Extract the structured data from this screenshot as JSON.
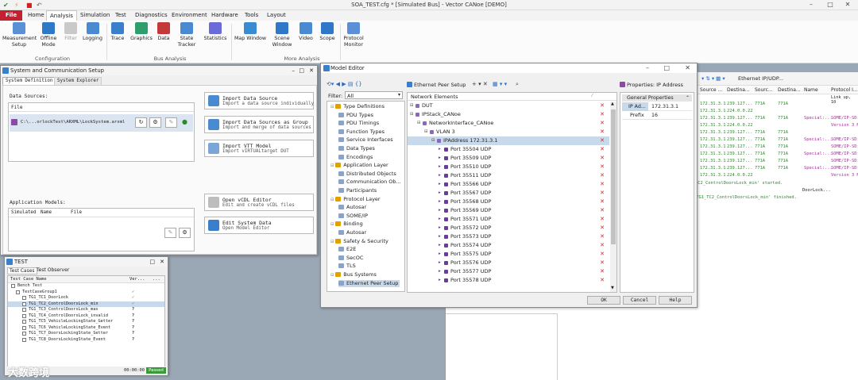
{
  "app": {
    "title": "SOA_TEST.cfg * [Simulated Bus] - Vector CANoe [DEMO]"
  },
  "menu": {
    "items": [
      "File",
      "Home",
      "Analysis",
      "Simulation",
      "Test",
      "Diagnostics",
      "Environment",
      "Hardware",
      "Tools",
      "Layout"
    ],
    "active": "Analysis"
  },
  "ribbon": {
    "buttons": [
      {
        "label": "Measurement\nSetup",
        "icon": "measurement-setup-icon"
      },
      {
        "label": "Offline\nMode",
        "icon": "offline-mode-icon"
      },
      {
        "label": "Filter",
        "icon": "filter-icon"
      },
      {
        "label": "Logging",
        "icon": "logging-icon"
      },
      {
        "label": "Trace",
        "icon": "trace-icon"
      },
      {
        "label": "Graphics",
        "icon": "graphics-icon"
      },
      {
        "label": "Data",
        "icon": "data-icon"
      },
      {
        "label": "State\nTracker",
        "icon": "state-tracker-icon"
      },
      {
        "label": "Statistics",
        "icon": "statistics-icon"
      },
      {
        "label": "Map Window",
        "icon": "map-window-icon"
      },
      {
        "label": "Scene\nWindow",
        "icon": "scene-window-icon"
      },
      {
        "label": "Video",
        "icon": "video-icon"
      },
      {
        "label": "Scope",
        "icon": "scope-icon"
      },
      {
        "label": "Protocol\nMonitor",
        "icon": "protocol-monitor-icon"
      }
    ],
    "groups": [
      "Configuration",
      "Bus Analysis",
      "More Analysis"
    ]
  },
  "setup": {
    "title": "System and Communication Setup",
    "tabs": [
      "System Definition",
      "System Explorer"
    ],
    "data_sources_label": "Data Sources:",
    "file_col": "File",
    "file_value": "C:\\...orlockTest\\ARXML\\LockSystem.arxml",
    "app_models_label": "Application Models:",
    "app_cols": [
      "Simulated",
      "Name",
      "File"
    ],
    "actions": [
      {
        "title": "Import Data Source",
        "sub": "Import a data source individually"
      },
      {
        "title": "Import Data Sources as Group",
        "sub": "Import and merge of data sources"
      },
      {
        "title": "Import VTT Model",
        "sub": "Import vIRTUALtarget DUT"
      },
      {
        "title": "Open vCDL Editor",
        "sub": "Edit and create vCDL files"
      },
      {
        "title": "Edit System Data",
        "sub": "Open Model Editor"
      }
    ]
  },
  "test": {
    "title": "TEST",
    "tabs": [
      "Test Cases",
      "Test Observer"
    ],
    "cols": [
      "Test Case Name",
      "Ver...",
      "..."
    ],
    "items": [
      {
        "name": "Bench Test",
        "verdict": ""
      },
      {
        "name": "TestCaseGroup1",
        "verdict": "✓"
      },
      {
        "name": "TG1_TC1_DoorLock",
        "verdict": "✓"
      },
      {
        "name": "TG1_TC2_ControlDoorsLock_min",
        "verdict": "✓"
      },
      {
        "name": "TG1_TC3_ControlDoorsLock_max",
        "verdict": "?"
      },
      {
        "name": "TG1_TC4_ControlDoorsLock_invalid",
        "verdict": "?"
      },
      {
        "name": "TG1_TC5_VehicleLockingState_Getter",
        "verdict": "?"
      },
      {
        "name": "TG1_TC6_VehicleLockingState_Event",
        "verdict": "?"
      },
      {
        "name": "TG1_TC7_DoorsLockingState_Setter",
        "verdict": "?"
      },
      {
        "name": "TG1_TC8_DoorsLockingState_Event",
        "verdict": "?"
      }
    ],
    "time": "00:00:00",
    "status": "Passed",
    "watermark": "大数跨境"
  },
  "model_editor": {
    "title": "Model Editor",
    "filter_label": "Filter:",
    "filter_value": "All",
    "tree": [
      {
        "label": "Type Definitions",
        "level": 1
      },
      {
        "label": "PDU Types",
        "level": 2
      },
      {
        "label": "PDU Timings",
        "level": 2
      },
      {
        "label": "Function Types",
        "level": 2
      },
      {
        "label": "Service Interfaces",
        "level": 2
      },
      {
        "label": "Data Types",
        "level": 2
      },
      {
        "label": "Encodings",
        "level": 2
      },
      {
        "label": "Application Layer",
        "level": 1
      },
      {
        "label": "Distributed Objects",
        "level": 2
      },
      {
        "label": "Communication Ob...",
        "level": 2
      },
      {
        "label": "Participants",
        "level": 2
      },
      {
        "label": "Protocol Layer",
        "level": 1
      },
      {
        "label": "Autosar",
        "level": 2
      },
      {
        "label": "SOME/IP",
        "level": 2
      },
      {
        "label": "Binding",
        "level": 1
      },
      {
        "label": "Autosar",
        "level": 2
      },
      {
        "label": "Safety & Security",
        "level": 1
      },
      {
        "label": "E2E",
        "level": 2
      },
      {
        "label": "SecOC",
        "level": 2
      },
      {
        "label": "TLS",
        "level": 2
      },
      {
        "label": "Bus Systems",
        "level": 1
      },
      {
        "label": "Ethernet Peer Setup",
        "level": 2
      }
    ],
    "peer_setup_title": "Ethernet Peer Setup",
    "network_header": "Network Elements",
    "network_rows": [
      {
        "label": "DUT",
        "level": 0
      },
      {
        "label": "IPStack_CANoe",
        "level": 0
      },
      {
        "label": "NetworkInterface_CANoe",
        "level": 1
      },
      {
        "label": "VLAN 3",
        "level": 2
      },
      {
        "label": "IPAddress 172.31.3.1",
        "level": 3
      },
      {
        "label": "Port 35504 UDP",
        "level": 4
      },
      {
        "label": "Port 35509 UDP",
        "level": 4
      },
      {
        "label": "Port 35510 UDP",
        "level": 4
      },
      {
        "label": "Port 35511 UDP",
        "level": 4
      },
      {
        "label": "Port 35566 UDP",
        "level": 4
      },
      {
        "label": "Port 35567 UDP",
        "level": 4
      },
      {
        "label": "Port 35568 UDP",
        "level": 4
      },
      {
        "label": "Port 35569 UDP",
        "level": 4
      },
      {
        "label": "Port 35571 UDP",
        "level": 4
      },
      {
        "label": "Port 35572 UDP",
        "level": 4
      },
      {
        "label": "Port 35573 UDP",
        "level": 4
      },
      {
        "label": "Port 35574 UDP",
        "level": 4
      },
      {
        "label": "Port 35575 UDP",
        "level": 4
      },
      {
        "label": "Port 35576 UDP",
        "level": 4
      },
      {
        "label": "Port 35577 UDP",
        "level": 4
      },
      {
        "label": "Port 35578 UDP",
        "level": 4
      }
    ],
    "props_title": "Properties: IP Address",
    "props_header": "General Properties",
    "props": [
      {
        "key": "IP Ad...",
        "value": "172.31.3.1"
      },
      {
        "key": "Prefix",
        "value": "16"
      }
    ],
    "buttons": {
      "ok": "OK",
      "cancel": "Cancel",
      "help": "Help"
    }
  },
  "trace": {
    "toolbar_label": "Ethernet IP/UDP...",
    "cols": [
      "Source ...",
      "Destina...",
      "Sourc...",
      "Destina...",
      "Name",
      "Protocol I..."
    ],
    "link_up": "Link up, 10",
    "rows": [
      {
        "src": "172.31.3.1",
        "dst": "239.127...",
        "sp": "771A",
        "dp": "771A",
        "name": "",
        "proto": ""
      },
      {
        "src": "172.31.3.1",
        "dst": "224.0.0.22",
        "sp": "",
        "dp": "",
        "name": "",
        "proto": ""
      },
      {
        "src": "172.31.3.1",
        "dst": "239.127...",
        "sp": "771A",
        "dp": "771A",
        "name": "Special:...",
        "proto": "SOME/IP-SD:"
      },
      {
        "src": "172.31.3.1",
        "dst": "224.0.0.22",
        "sp": "",
        "dp": "",
        "name": "",
        "proto": "Version 3 M"
      },
      {
        "src": "172.31.3.1",
        "dst": "239.127...",
        "sp": "771A",
        "dp": "771A",
        "name": "",
        "proto": ""
      },
      {
        "src": "172.31.3.1",
        "dst": "239.127...",
        "sp": "771A",
        "dp": "771A",
        "name": "Special:...",
        "proto": "SOME/IP-SD:"
      },
      {
        "src": "172.31.3.1",
        "dst": "239.127...",
        "sp": "771A",
        "dp": "771A",
        "name": "",
        "proto": "SOME/IP-SD:"
      },
      {
        "src": "172.31.3.1",
        "dst": "239.127...",
        "sp": "771A",
        "dp": "771A",
        "name": "Special:...",
        "proto": "SOME/IP-SD:"
      },
      {
        "src": "172.31.3.1",
        "dst": "239.127...",
        "sp": "771A",
        "dp": "771A",
        "name": "",
        "proto": "SOME/IP-SD:"
      },
      {
        "src": "172.31.3.1",
        "dst": "239.127...",
        "sp": "771A",
        "dp": "771A",
        "name": "Special:...",
        "proto": "SOME/IP-SD:"
      },
      {
        "src": "172.31.3.1",
        "dst": "224.0.0.22",
        "sp": "",
        "dp": "",
        "name": "",
        "proto": "Version 3 M"
      }
    ],
    "msg1": "TC2_ControlDoorsLock_min' started.",
    "msg2": "'TG1_TC2_ControlDoorsLock_min' finished.",
    "msg_name": "DoorLock..."
  }
}
